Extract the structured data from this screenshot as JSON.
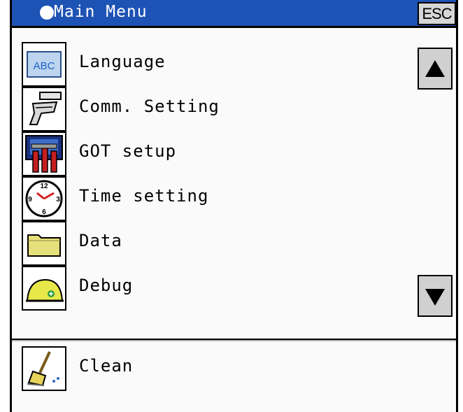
{
  "titlebar": {
    "title": "Main Menu",
    "esc_label": "ESC"
  },
  "menu": {
    "items": [
      {
        "label": "Language",
        "icon": "abc-icon"
      },
      {
        "label": "Comm. Setting",
        "icon": "cable-icon"
      },
      {
        "label": "GOT setup",
        "icon": "monitor-tools-icon"
      },
      {
        "label": "Time setting",
        "icon": "clock-icon"
      },
      {
        "label": "Data",
        "icon": "folder-icon"
      },
      {
        "label": "Debug",
        "icon": "helmet-icon"
      }
    ]
  },
  "footer": {
    "clean_label": "Clean",
    "clean_icon": "broom-icon"
  },
  "icon_text": {
    "abc": "ABC",
    "clock_12": "12",
    "clock_9": "9",
    "clock_3": "3",
    "clock_6": "6"
  },
  "colors": {
    "titlebar": "#1d53b4",
    "button": "#d0d0d0",
    "folder": "#e6e07a",
    "helmet": "#e8e84a"
  }
}
